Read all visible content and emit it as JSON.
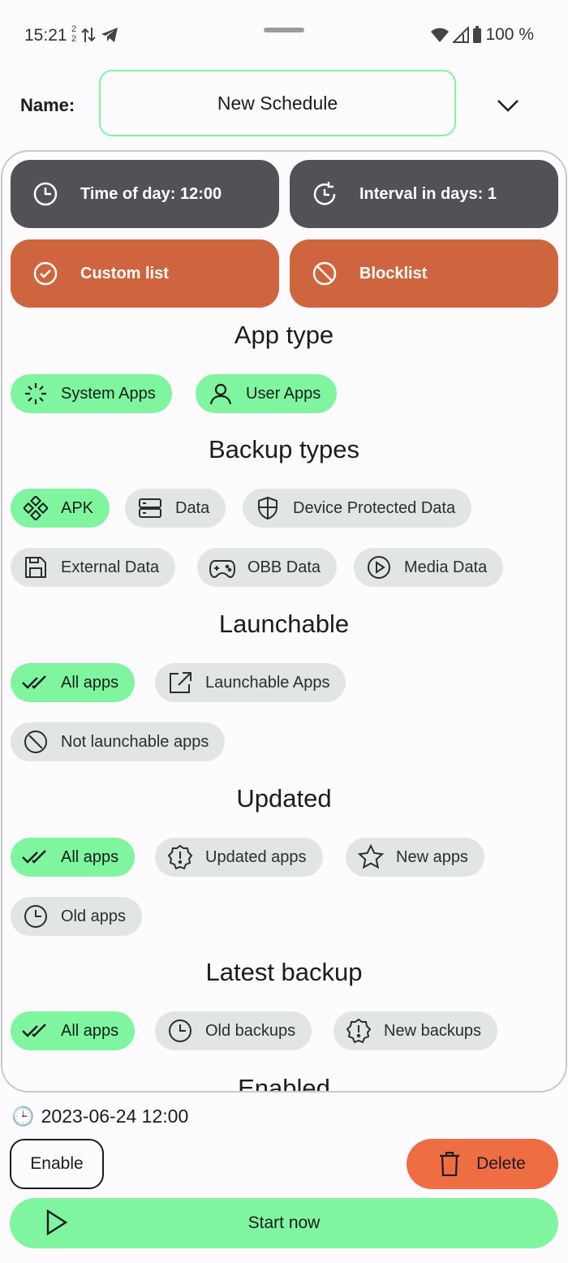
{
  "status_bar": {
    "time": "15:21",
    "notif_sup": "2",
    "notif_sub": "2",
    "battery": "100 %"
  },
  "header": {
    "name_label": "Name:",
    "name_value": "New Schedule"
  },
  "controls": {
    "time_of_day": "Time of day: 12:00",
    "interval": "Interval in days: 1",
    "custom_list": "Custom list",
    "blocklist": "Blocklist"
  },
  "sections": {
    "app_type": {
      "title": "App type",
      "chips": [
        {
          "label": "System Apps",
          "selected": true,
          "icon": "system-apps-icon"
        },
        {
          "label": "User Apps",
          "selected": true,
          "icon": "user-icon"
        }
      ]
    },
    "backup_types": {
      "title": "Backup types",
      "chips": [
        {
          "label": "APK",
          "selected": true,
          "icon": "apk-icon"
        },
        {
          "label": "Data",
          "selected": false,
          "icon": "storage-icon"
        },
        {
          "label": "Device Protected Data",
          "selected": false,
          "icon": "shield-icon"
        },
        {
          "label": "External Data",
          "selected": false,
          "icon": "floppy-icon"
        },
        {
          "label": "OBB Data",
          "selected": false,
          "icon": "gamepad-icon"
        },
        {
          "label": "Media Data",
          "selected": false,
          "icon": "play-circle-icon"
        }
      ]
    },
    "launchable": {
      "title": "Launchable",
      "chips": [
        {
          "label": "All apps",
          "selected": true,
          "icon": "double-check-icon"
        },
        {
          "label": "Launchable Apps",
          "selected": false,
          "icon": "external-link-icon"
        },
        {
          "label": "Not launchable apps",
          "selected": false,
          "icon": "prohibited-icon"
        }
      ]
    },
    "updated": {
      "title": "Updated",
      "chips": [
        {
          "label": "All apps",
          "selected": true,
          "icon": "double-check-icon"
        },
        {
          "label": "Updated apps",
          "selected": false,
          "icon": "alert-badge-icon"
        },
        {
          "label": "New apps",
          "selected": false,
          "icon": "star-icon"
        },
        {
          "label": "Old apps",
          "selected": false,
          "icon": "clock-icon"
        }
      ]
    },
    "latest_backup": {
      "title": "Latest backup",
      "chips": [
        {
          "label": "All apps",
          "selected": true,
          "icon": "double-check-icon"
        },
        {
          "label": "Old backups",
          "selected": false,
          "icon": "clock-icon"
        },
        {
          "label": "New backups",
          "selected": false,
          "icon": "alert-badge-icon"
        }
      ]
    },
    "enabled": {
      "title": "Enabled"
    }
  },
  "footer": {
    "next_run_icon": "🕒",
    "next_run": "2023-06-24 12:00",
    "enable_label": "Enable",
    "delete_label": "Delete",
    "start_label": "Start now"
  },
  "colors": {
    "accent_green": "#7ff59f",
    "dark_button": "#505255",
    "orange_button": "#cf653e",
    "delete_orange": "#ef6d43",
    "chip_off": "#e1e6e4"
  }
}
